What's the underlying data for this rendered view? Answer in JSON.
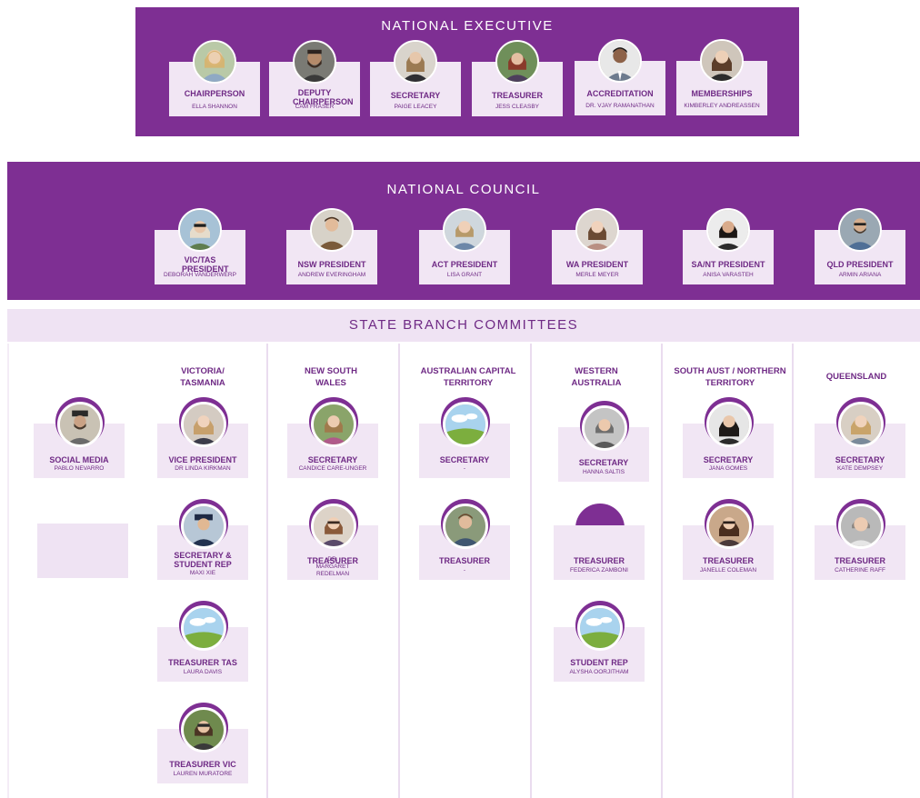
{
  "executive": {
    "title": "NATIONAL EXECUTIVE",
    "members": [
      {
        "role": "CHAIRPERSON",
        "name": "ELLA SHANNON",
        "photo": "portrait-blonde-woman"
      },
      {
        "role": "DEPUTY CHAIRPERSON",
        "name": "CAM FRASER",
        "photo": "portrait-bearded-man"
      },
      {
        "role": "SECRETARY",
        "name": "PAIGE LEACEY",
        "photo": "portrait-woman"
      },
      {
        "role": "TREASURER",
        "name": "JESS CLEASBY",
        "photo": "portrait-woman-outdoor"
      },
      {
        "role": "ACCREDITATION",
        "name": "DR. VJAY RAMANATHAN",
        "photo": "portrait-man-suit"
      },
      {
        "role": "MEMBERSHIPS",
        "name": "KIMBERLEY ANDREASSEN",
        "photo": "portrait-smiling-woman"
      }
    ]
  },
  "council": {
    "title": "NATIONAL COUNCIL",
    "members": [
      {
        "role": "VIC/TAS PRESIDENT",
        "name": "DEBORAH VANDERWERP",
        "photo": "portrait-woman-sunglasses"
      },
      {
        "role": "NSW PRESIDENT",
        "name": "ANDREW EVERINGHAM",
        "photo": "portrait-man"
      },
      {
        "role": "ACT PRESIDENT",
        "name": "LISA GRANT",
        "photo": "portrait-woman-glasses"
      },
      {
        "role": "WA PRESIDENT",
        "name": "MERLE MEYER",
        "photo": "portrait-woman"
      },
      {
        "role": "SA/NT PRESIDENT",
        "name": "ANISA VARASTEH",
        "photo": "portrait-dark-hair-woman"
      },
      {
        "role": "QLD PRESIDENT",
        "name": "ARMIN ARIANA",
        "photo": "portrait-man-glasses"
      }
    ]
  },
  "state": {
    "title": "STATE BRANCH COMMITTEES",
    "columns": [
      {
        "heading": "",
        "cards": [
          {
            "role": "SOCIAL MEDIA",
            "name": "PABLO NEVARRO",
            "photo": "portrait-man-hat"
          }
        ]
      },
      {
        "heading": "VICTORIA/ TASMANIA",
        "cards": [
          {
            "role": "VICE PRESIDENT",
            "name": "DR LINDA KIRKMAN",
            "photo": "portrait-woman"
          },
          {
            "role": "SECRETARY & STUDENT REP",
            "name": "MAXI XIE",
            "photo": "portrait-man-cap"
          },
          {
            "role": "TREASURER TAS",
            "name": "LAURA DAVIS",
            "photo": "placeholder-landscape"
          },
          {
            "role": "TREASURER VIC",
            "name": "LAUREN MURATORE",
            "photo": "portrait-woman-outdoor"
          }
        ]
      },
      {
        "heading": "NEW SOUTH WALES",
        "cards": [
          {
            "role": "SECRETARY",
            "name": "CANDICE CARE-UNGER",
            "photo": "portrait-woman"
          },
          {
            "role": "TREASURER",
            "name": "DR. MARGARET REDELMAN",
            "photo": "portrait-woman-glasses"
          }
        ]
      },
      {
        "heading": "AUSTRALIAN CAPITAL TERRITORY",
        "cards": [
          {
            "role": "SECRETARY",
            "name": "-",
            "photo": "placeholder-landscape"
          },
          {
            "role": "TREASURER",
            "name": "-",
            "photo": "portrait-man"
          }
        ]
      },
      {
        "heading": "WESTERN AUSTRALIA",
        "cards": [
          {
            "role": "SECRETARY",
            "name": "HANNA SALTIS",
            "photo": "portrait-woman"
          },
          {
            "role": "TREASURER",
            "name": "FEDERICA ZAMBONI",
            "photo": ""
          },
          {
            "role": "STUDENT REP",
            "name": "ALYSHA OORJITHAM",
            "photo": "placeholder-landscape"
          }
        ]
      },
      {
        "heading": "SOUTH AUST / NORTHERN TERRITORY",
        "cards": [
          {
            "role": "SECRETARY",
            "name": "JANA GOMES",
            "photo": "portrait-dark-hair-woman"
          },
          {
            "role": "TREASURER",
            "name": "JANELLE COLEMAN",
            "photo": "portrait-woman-glasses"
          }
        ]
      },
      {
        "heading": "QUEENSLAND",
        "cards": [
          {
            "role": "SECRETARY",
            "name": "KATE DEMPSEY",
            "photo": "portrait-blonde-woman"
          },
          {
            "role": "TREASURER",
            "name": "CATHERINE RAFF",
            "photo": "portrait-woman"
          }
        ]
      }
    ]
  },
  "colors": {
    "purple": "#7e2f93",
    "card": "#f1e6f4",
    "text": "#6f2a85"
  }
}
